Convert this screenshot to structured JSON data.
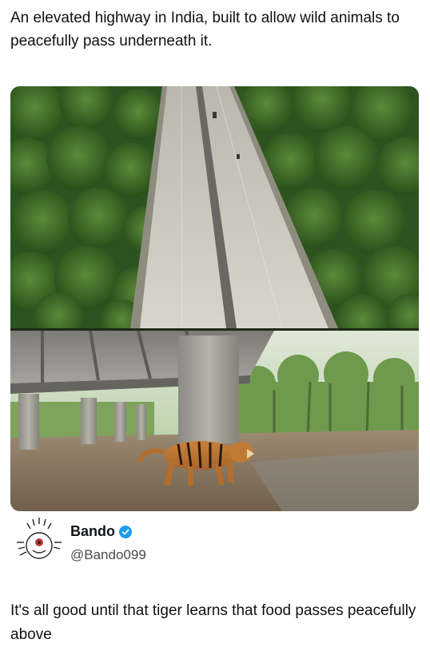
{
  "post": {
    "caption": "An elevated highway in India, built to allow wild animals to peacefully pass underneath it."
  },
  "image": {
    "top_panel": "aerial-view-elevated-highway",
    "bottom_panel": "tiger-walking-under-highway"
  },
  "author": {
    "name": "Bando",
    "handle": "@Bando099",
    "verified": true,
    "badge_color": "#1d9bf0"
  },
  "reply": {
    "text": "It's all good until that tiger learns that food passes peacefully above"
  },
  "colors": {
    "text": "#111111",
    "handle": "#4a4a4a",
    "forest": "#2f5a22"
  }
}
